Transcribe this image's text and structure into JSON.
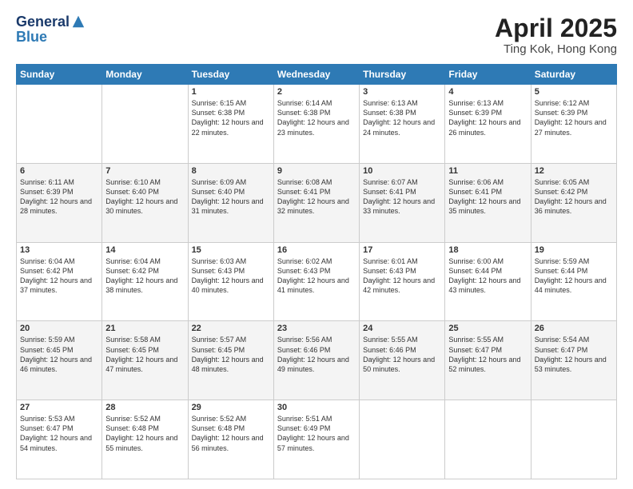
{
  "header": {
    "logo_general": "General",
    "logo_blue": "Blue",
    "title": "April 2025",
    "location": "Ting Kok, Hong Kong"
  },
  "weekdays": [
    "Sunday",
    "Monday",
    "Tuesday",
    "Wednesday",
    "Thursday",
    "Friday",
    "Saturday"
  ],
  "weeks": [
    [
      {
        "day": "",
        "sunrise": "",
        "sunset": "",
        "daylight": ""
      },
      {
        "day": "",
        "sunrise": "",
        "sunset": "",
        "daylight": ""
      },
      {
        "day": "1",
        "sunrise": "Sunrise: 6:15 AM",
        "sunset": "Sunset: 6:38 PM",
        "daylight": "Daylight: 12 hours and 22 minutes."
      },
      {
        "day": "2",
        "sunrise": "Sunrise: 6:14 AM",
        "sunset": "Sunset: 6:38 PM",
        "daylight": "Daylight: 12 hours and 23 minutes."
      },
      {
        "day": "3",
        "sunrise": "Sunrise: 6:13 AM",
        "sunset": "Sunset: 6:38 PM",
        "daylight": "Daylight: 12 hours and 24 minutes."
      },
      {
        "day": "4",
        "sunrise": "Sunrise: 6:13 AM",
        "sunset": "Sunset: 6:39 PM",
        "daylight": "Daylight: 12 hours and 26 minutes."
      },
      {
        "day": "5",
        "sunrise": "Sunrise: 6:12 AM",
        "sunset": "Sunset: 6:39 PM",
        "daylight": "Daylight: 12 hours and 27 minutes."
      }
    ],
    [
      {
        "day": "6",
        "sunrise": "Sunrise: 6:11 AM",
        "sunset": "Sunset: 6:39 PM",
        "daylight": "Daylight: 12 hours and 28 minutes."
      },
      {
        "day": "7",
        "sunrise": "Sunrise: 6:10 AM",
        "sunset": "Sunset: 6:40 PM",
        "daylight": "Daylight: 12 hours and 30 minutes."
      },
      {
        "day": "8",
        "sunrise": "Sunrise: 6:09 AM",
        "sunset": "Sunset: 6:40 PM",
        "daylight": "Daylight: 12 hours and 31 minutes."
      },
      {
        "day": "9",
        "sunrise": "Sunrise: 6:08 AM",
        "sunset": "Sunset: 6:41 PM",
        "daylight": "Daylight: 12 hours and 32 minutes."
      },
      {
        "day": "10",
        "sunrise": "Sunrise: 6:07 AM",
        "sunset": "Sunset: 6:41 PM",
        "daylight": "Daylight: 12 hours and 33 minutes."
      },
      {
        "day": "11",
        "sunrise": "Sunrise: 6:06 AM",
        "sunset": "Sunset: 6:41 PM",
        "daylight": "Daylight: 12 hours and 35 minutes."
      },
      {
        "day": "12",
        "sunrise": "Sunrise: 6:05 AM",
        "sunset": "Sunset: 6:42 PM",
        "daylight": "Daylight: 12 hours and 36 minutes."
      }
    ],
    [
      {
        "day": "13",
        "sunrise": "Sunrise: 6:04 AM",
        "sunset": "Sunset: 6:42 PM",
        "daylight": "Daylight: 12 hours and 37 minutes."
      },
      {
        "day": "14",
        "sunrise": "Sunrise: 6:04 AM",
        "sunset": "Sunset: 6:42 PM",
        "daylight": "Daylight: 12 hours and 38 minutes."
      },
      {
        "day": "15",
        "sunrise": "Sunrise: 6:03 AM",
        "sunset": "Sunset: 6:43 PM",
        "daylight": "Daylight: 12 hours and 40 minutes."
      },
      {
        "day": "16",
        "sunrise": "Sunrise: 6:02 AM",
        "sunset": "Sunset: 6:43 PM",
        "daylight": "Daylight: 12 hours and 41 minutes."
      },
      {
        "day": "17",
        "sunrise": "Sunrise: 6:01 AM",
        "sunset": "Sunset: 6:43 PM",
        "daylight": "Daylight: 12 hours and 42 minutes."
      },
      {
        "day": "18",
        "sunrise": "Sunrise: 6:00 AM",
        "sunset": "Sunset: 6:44 PM",
        "daylight": "Daylight: 12 hours and 43 minutes."
      },
      {
        "day": "19",
        "sunrise": "Sunrise: 5:59 AM",
        "sunset": "Sunset: 6:44 PM",
        "daylight": "Daylight: 12 hours and 44 minutes."
      }
    ],
    [
      {
        "day": "20",
        "sunrise": "Sunrise: 5:59 AM",
        "sunset": "Sunset: 6:45 PM",
        "daylight": "Daylight: 12 hours and 46 minutes."
      },
      {
        "day": "21",
        "sunrise": "Sunrise: 5:58 AM",
        "sunset": "Sunset: 6:45 PM",
        "daylight": "Daylight: 12 hours and 47 minutes."
      },
      {
        "day": "22",
        "sunrise": "Sunrise: 5:57 AM",
        "sunset": "Sunset: 6:45 PM",
        "daylight": "Daylight: 12 hours and 48 minutes."
      },
      {
        "day": "23",
        "sunrise": "Sunrise: 5:56 AM",
        "sunset": "Sunset: 6:46 PM",
        "daylight": "Daylight: 12 hours and 49 minutes."
      },
      {
        "day": "24",
        "sunrise": "Sunrise: 5:55 AM",
        "sunset": "Sunset: 6:46 PM",
        "daylight": "Daylight: 12 hours and 50 minutes."
      },
      {
        "day": "25",
        "sunrise": "Sunrise: 5:55 AM",
        "sunset": "Sunset: 6:47 PM",
        "daylight": "Daylight: 12 hours and 52 minutes."
      },
      {
        "day": "26",
        "sunrise": "Sunrise: 5:54 AM",
        "sunset": "Sunset: 6:47 PM",
        "daylight": "Daylight: 12 hours and 53 minutes."
      }
    ],
    [
      {
        "day": "27",
        "sunrise": "Sunrise: 5:53 AM",
        "sunset": "Sunset: 6:47 PM",
        "daylight": "Daylight: 12 hours and 54 minutes."
      },
      {
        "day": "28",
        "sunrise": "Sunrise: 5:52 AM",
        "sunset": "Sunset: 6:48 PM",
        "daylight": "Daylight: 12 hours and 55 minutes."
      },
      {
        "day": "29",
        "sunrise": "Sunrise: 5:52 AM",
        "sunset": "Sunset: 6:48 PM",
        "daylight": "Daylight: 12 hours and 56 minutes."
      },
      {
        "day": "30",
        "sunrise": "Sunrise: 5:51 AM",
        "sunset": "Sunset: 6:49 PM",
        "daylight": "Daylight: 12 hours and 57 minutes."
      },
      {
        "day": "",
        "sunrise": "",
        "sunset": "",
        "daylight": ""
      },
      {
        "day": "",
        "sunrise": "",
        "sunset": "",
        "daylight": ""
      },
      {
        "day": "",
        "sunrise": "",
        "sunset": "",
        "daylight": ""
      }
    ]
  ]
}
